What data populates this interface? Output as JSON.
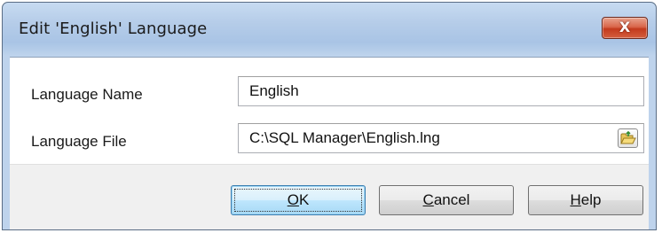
{
  "window": {
    "title": "Edit 'English' Language",
    "close_glyph": "X"
  },
  "form": {
    "language_name": {
      "label": "Language Name",
      "value": "English"
    },
    "language_file": {
      "label": "Language File",
      "value": "C:\\SQL Manager\\English.lng",
      "browse_icon": "folder-open-icon"
    }
  },
  "buttons": {
    "ok": {
      "accel": "O",
      "rest": "K"
    },
    "cancel": {
      "accel": "C",
      "rest": "ancel"
    },
    "help": {
      "accel": "H",
      "rest": "elp"
    }
  },
  "colors": {
    "titlebar": "#b6cde9",
    "close_button": "#c33a1d",
    "default_button_border": "#3c7fb1"
  }
}
